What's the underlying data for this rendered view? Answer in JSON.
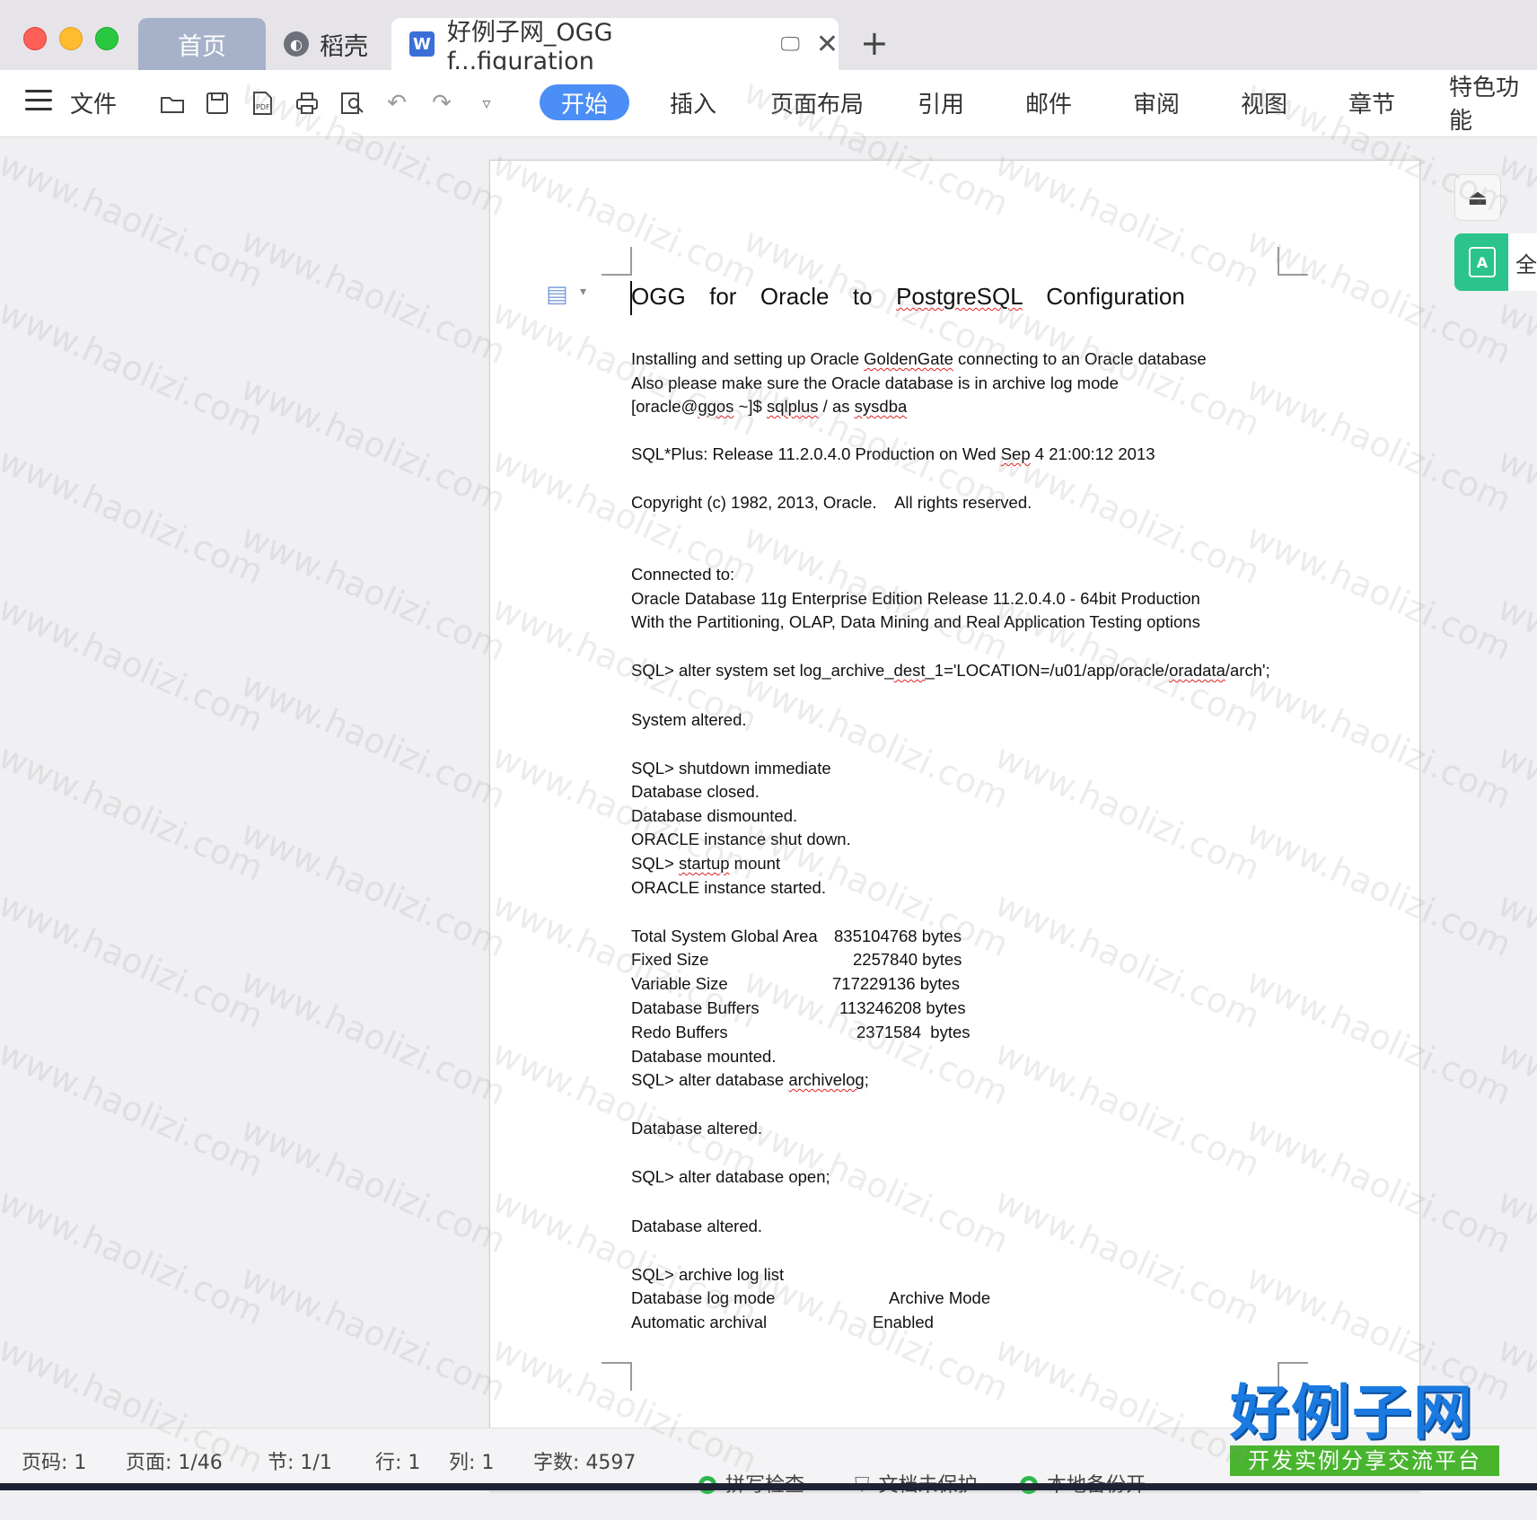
{
  "tabs": {
    "home": "首页",
    "daoke": "稻壳",
    "document": "好例子网_OGG f...figuration",
    "new_tab": "+"
  },
  "ribbon": {
    "file_menu": "文件",
    "tabs": [
      "开始",
      "插入",
      "页面布局",
      "引用",
      "邮件",
      "审阅",
      "视图",
      "章节",
      "特色功能"
    ]
  },
  "document": {
    "title_parts": [
      "OGG  for  Oracle  to  ",
      "PostgreSQL",
      "  Configuration"
    ],
    "lines": {
      "l1a": "Installing and setting up Oracle ",
      "l1b": "GoldenGate",
      "l1c": " connecting to an Oracle database",
      "l2": "Also please make sure the Oracle database is in archive log mode",
      "l3a": "[oracle@",
      "l3b": "ggos",
      "l3c": " ~]$ ",
      "l3d": "sqlplus",
      "l3e": " / as ",
      "l3f": "sysdba",
      "l4a": "SQL*Plus: Release 11.2.0.4.0 Production on Wed ",
      "l4b": "Sep",
      "l4c": " 4 21:00:12 2013",
      "l5": "Copyright (c) 1982, 2013, Oracle.    All rights reserved.",
      "l6": "Connected to:",
      "l7": "Oracle Database 11g Enterprise Edition Release 11.2.0.4.0 - 64bit Production",
      "l8": "With the Partitioning, OLAP, Data Mining and Real Application Testing options",
      "l9a": "SQL> alter system set log_archive_",
      "l9b": "dest",
      "l9c": "_1='LOCATION=/u01/app/oracle/",
      "l9d": "oradata",
      "l9e": "/arch';",
      "l10": "System altered.",
      "l11": "SQL> shutdown immediate",
      "l12": "Database closed.",
      "l13": "Database dismounted.",
      "l14": "ORACLE instance shut down.",
      "l15a": "SQL> ",
      "l15b": "startup",
      "l15c": " mount",
      "l16": "ORACLE instance started.",
      "sga_label": "Total System Global Area",
      "sga_value": "835104768 bytes",
      "fixed_label": "Fixed Size",
      "fixed_value": "2257840 bytes",
      "var_label": "Variable Size",
      "var_value": "717229136 bytes",
      "dbbuf_label": "Database Buffers",
      "dbbuf_value": "113246208 bytes",
      "redo_label": "Redo Buffers",
      "redo_value": "2371584  bytes",
      "l17": "Database mounted.",
      "l18a": "SQL> alter database ",
      "l18b": "archivelog",
      "l18c": ";",
      "l19": "Database altered.",
      "l20": "SQL> alter database open;",
      "l21": "Database altered.",
      "l22": "SQL> archive log list",
      "logmode_label": "Database log mode",
      "logmode_value": "Archive Mode",
      "autoarch_label": "Automatic archival",
      "autoarch_value": "Enabled"
    }
  },
  "side": {
    "translate_label": "全"
  },
  "status": {
    "page_code": "页码: 1",
    "page": "页面: 1/46",
    "section": "节: 1/1",
    "row": "行: 1",
    "col": "列: 1",
    "word_count": "字数: 4597",
    "spell_check": "拼写检查",
    "doc_protect": "文档未保护",
    "local_backup": "本地备份开"
  },
  "logo": {
    "main": "好例子网",
    "sub": "开发实例分享交流平台"
  },
  "watermark": "www.haolizi.com"
}
